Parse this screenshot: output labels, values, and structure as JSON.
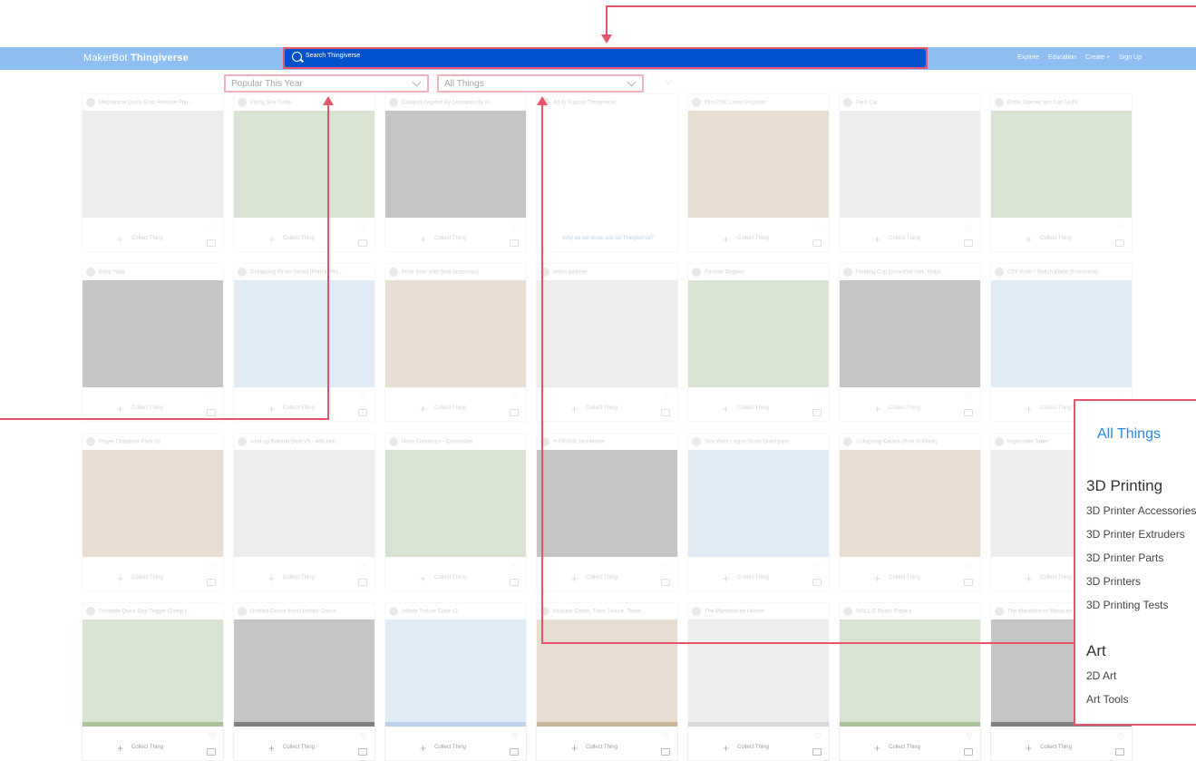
{
  "navbar": {
    "logo_light": "MakerBot",
    "logo_bold": "Thingiverse",
    "search_placeholder": "Search Thingiverse",
    "links": [
      "Explore",
      "Education",
      "Create +",
      "Sign Up"
    ]
  },
  "filters": {
    "sort": "Popular This Year",
    "category": "All Things"
  },
  "card_common": {
    "collect_label": "Collect Thing",
    "ad_link": "Why do we show ads on Thingiverse?"
  },
  "cards": [
    {
      "title": "Mechanical Quick Grab Release Pho..."
    },
    {
      "title": "Flying Sea Turtle"
    },
    {
      "title": "Catapult Inspired By Leonardo da Vi..."
    },
    {
      "title": "Ad to Support Thingiverse"
    },
    {
      "title": "Mini CNC Laser Engraver"
    },
    {
      "title": "Flexi Cat"
    },
    {
      "title": "Bottle Opener and Cap GUN!"
    },
    {
      "title": "Baby Yoda"
    },
    {
      "title": "Collapsing Pirate Sword (Print in Pla..."
    },
    {
      "title": "Polar Bear with Seal (automata)"
    },
    {
      "title": "rettes polisher"
    },
    {
      "title": "Panther Origami"
    },
    {
      "title": "Floating Cup (smoother look, foolpr..."
    },
    {
      "title": "OTF Knife / Switch Blade (Functional)"
    },
    {
      "title": "Player Character Pack 02"
    },
    {
      "title": "wind-up Bathtub Boat V5 - with beri..."
    },
    {
      "title": "Hose Connector - Customizer"
    },
    {
      "title": "A-FRAME bird feeder"
    },
    {
      "title": "Star Wars Legion Scale Droid pack"
    },
    {
      "title": "Collapsing Katana (Print in Place)"
    },
    {
      "title": "Impossible Table"
    },
    {
      "title": "Printable Quick Grip Trigger Clamp (..."
    },
    {
      "title": "Untitled Goose from Untitled Goose..."
    },
    {
      "title": "Infinite Torture Cube v2"
    },
    {
      "title": "Modular Castle, Town, House, Tower..."
    },
    {
      "title": "The Mandalorian Helmet"
    },
    {
      "title": "WALL-E Robot Replica"
    },
    {
      "title": "The Mandalorian Miniature"
    }
  ],
  "category_menu": {
    "title": "All Things",
    "sections": [
      {
        "name": "3D Printing",
        "items": [
          "3D Printer Accessories",
          "3D Printer Extruders",
          "3D Printer Parts",
          "3D Printers",
          "3D Printing Tests"
        ]
      },
      {
        "name": "Art",
        "items": [
          "2D Art",
          "Art Tools"
        ]
      }
    ]
  },
  "colors": {
    "navbar": "#8fbff2",
    "search": "#0052cc",
    "highlight": "#e5566a",
    "menu_title": "#2e86de"
  }
}
